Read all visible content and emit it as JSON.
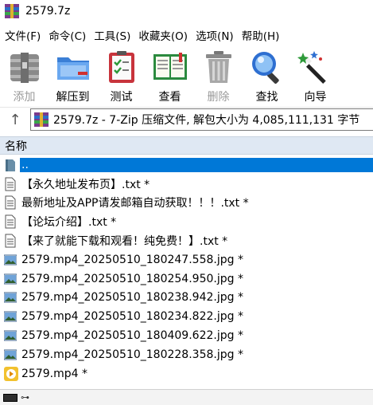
{
  "window": {
    "title": "2579.7z"
  },
  "menu": [
    "文件(F)",
    "命令(C)",
    "工具(S)",
    "收藏夹(O)",
    "选项(N)",
    "帮助(H)"
  ],
  "toolbar": [
    {
      "label": "添加",
      "icon": "add-archive-icon",
      "enabled": false
    },
    {
      "label": "解压到",
      "icon": "extract-folder-icon",
      "enabled": true
    },
    {
      "label": "测试",
      "icon": "test-checklist-icon",
      "enabled": true
    },
    {
      "label": "查看",
      "icon": "view-book-icon",
      "enabled": true
    },
    {
      "label": "删除",
      "icon": "trash-icon",
      "enabled": false
    },
    {
      "label": "查找",
      "icon": "magnifier-icon",
      "enabled": true
    },
    {
      "label": "向导",
      "icon": "wizard-wand-icon",
      "enabled": true
    }
  ],
  "address": {
    "text": "2579.7z - 7-Zip 压缩文件, 解包大小为 4,085,111,131 字节"
  },
  "list": {
    "column_name": "名称",
    "rows": [
      {
        "name": "..",
        "type": "folder-up",
        "selected": true
      },
      {
        "name": "【永久地址发布页】.txt *",
        "type": "txt"
      },
      {
        "name": "最新地址及APP请发邮箱自动获取！！！.txt *",
        "type": "txt"
      },
      {
        "name": "【论坛介绍】.txt *",
        "type": "txt"
      },
      {
        "name": "【来了就能下载和观看！纯免费！】.txt *",
        "type": "txt"
      },
      {
        "name": "2579.mp4_20250510_180247.558.jpg *",
        "type": "jpg"
      },
      {
        "name": "2579.mp4_20250510_180254.950.jpg *",
        "type": "jpg"
      },
      {
        "name": "2579.mp4_20250510_180238.942.jpg *",
        "type": "jpg"
      },
      {
        "name": "2579.mp4_20250510_180234.822.jpg *",
        "type": "jpg"
      },
      {
        "name": "2579.mp4_20250510_180409.622.jpg *",
        "type": "jpg"
      },
      {
        "name": "2579.mp4_20250510_180228.358.jpg *",
        "type": "jpg"
      },
      {
        "name": "2579.mp4 *",
        "type": "mp4"
      }
    ]
  },
  "colors": {
    "selection": "#0078d7",
    "header_bg": "#dfe8f3"
  }
}
